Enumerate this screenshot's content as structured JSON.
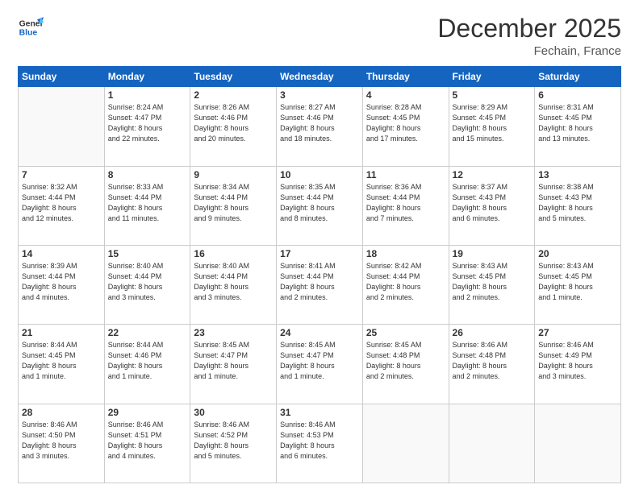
{
  "header": {
    "logo_general": "General",
    "logo_blue": "Blue",
    "month": "December 2025",
    "location": "Fechain, France"
  },
  "days_of_week": [
    "Sunday",
    "Monday",
    "Tuesday",
    "Wednesday",
    "Thursday",
    "Friday",
    "Saturday"
  ],
  "weeks": [
    [
      {
        "day": "",
        "info": ""
      },
      {
        "day": "1",
        "info": "Sunrise: 8:24 AM\nSunset: 4:47 PM\nDaylight: 8 hours\nand 22 minutes."
      },
      {
        "day": "2",
        "info": "Sunrise: 8:26 AM\nSunset: 4:46 PM\nDaylight: 8 hours\nand 20 minutes."
      },
      {
        "day": "3",
        "info": "Sunrise: 8:27 AM\nSunset: 4:46 PM\nDaylight: 8 hours\nand 18 minutes."
      },
      {
        "day": "4",
        "info": "Sunrise: 8:28 AM\nSunset: 4:45 PM\nDaylight: 8 hours\nand 17 minutes."
      },
      {
        "day": "5",
        "info": "Sunrise: 8:29 AM\nSunset: 4:45 PM\nDaylight: 8 hours\nand 15 minutes."
      },
      {
        "day": "6",
        "info": "Sunrise: 8:31 AM\nSunset: 4:45 PM\nDaylight: 8 hours\nand 13 minutes."
      }
    ],
    [
      {
        "day": "7",
        "info": "Sunrise: 8:32 AM\nSunset: 4:44 PM\nDaylight: 8 hours\nand 12 minutes."
      },
      {
        "day": "8",
        "info": "Sunrise: 8:33 AM\nSunset: 4:44 PM\nDaylight: 8 hours\nand 11 minutes."
      },
      {
        "day": "9",
        "info": "Sunrise: 8:34 AM\nSunset: 4:44 PM\nDaylight: 8 hours\nand 9 minutes."
      },
      {
        "day": "10",
        "info": "Sunrise: 8:35 AM\nSunset: 4:44 PM\nDaylight: 8 hours\nand 8 minutes."
      },
      {
        "day": "11",
        "info": "Sunrise: 8:36 AM\nSunset: 4:44 PM\nDaylight: 8 hours\nand 7 minutes."
      },
      {
        "day": "12",
        "info": "Sunrise: 8:37 AM\nSunset: 4:43 PM\nDaylight: 8 hours\nand 6 minutes."
      },
      {
        "day": "13",
        "info": "Sunrise: 8:38 AM\nSunset: 4:43 PM\nDaylight: 8 hours\nand 5 minutes."
      }
    ],
    [
      {
        "day": "14",
        "info": "Sunrise: 8:39 AM\nSunset: 4:44 PM\nDaylight: 8 hours\nand 4 minutes."
      },
      {
        "day": "15",
        "info": "Sunrise: 8:40 AM\nSunset: 4:44 PM\nDaylight: 8 hours\nand 3 minutes."
      },
      {
        "day": "16",
        "info": "Sunrise: 8:40 AM\nSunset: 4:44 PM\nDaylight: 8 hours\nand 3 minutes."
      },
      {
        "day": "17",
        "info": "Sunrise: 8:41 AM\nSunset: 4:44 PM\nDaylight: 8 hours\nand 2 minutes."
      },
      {
        "day": "18",
        "info": "Sunrise: 8:42 AM\nSunset: 4:44 PM\nDaylight: 8 hours\nand 2 minutes."
      },
      {
        "day": "19",
        "info": "Sunrise: 8:43 AM\nSunset: 4:45 PM\nDaylight: 8 hours\nand 2 minutes."
      },
      {
        "day": "20",
        "info": "Sunrise: 8:43 AM\nSunset: 4:45 PM\nDaylight: 8 hours\nand 1 minute."
      }
    ],
    [
      {
        "day": "21",
        "info": "Sunrise: 8:44 AM\nSunset: 4:45 PM\nDaylight: 8 hours\nand 1 minute."
      },
      {
        "day": "22",
        "info": "Sunrise: 8:44 AM\nSunset: 4:46 PM\nDaylight: 8 hours\nand 1 minute."
      },
      {
        "day": "23",
        "info": "Sunrise: 8:45 AM\nSunset: 4:47 PM\nDaylight: 8 hours\nand 1 minute."
      },
      {
        "day": "24",
        "info": "Sunrise: 8:45 AM\nSunset: 4:47 PM\nDaylight: 8 hours\nand 1 minute."
      },
      {
        "day": "25",
        "info": "Sunrise: 8:45 AM\nSunset: 4:48 PM\nDaylight: 8 hours\nand 2 minutes."
      },
      {
        "day": "26",
        "info": "Sunrise: 8:46 AM\nSunset: 4:48 PM\nDaylight: 8 hours\nand 2 minutes."
      },
      {
        "day": "27",
        "info": "Sunrise: 8:46 AM\nSunset: 4:49 PM\nDaylight: 8 hours\nand 3 minutes."
      }
    ],
    [
      {
        "day": "28",
        "info": "Sunrise: 8:46 AM\nSunset: 4:50 PM\nDaylight: 8 hours\nand 3 minutes."
      },
      {
        "day": "29",
        "info": "Sunrise: 8:46 AM\nSunset: 4:51 PM\nDaylight: 8 hours\nand 4 minutes."
      },
      {
        "day": "30",
        "info": "Sunrise: 8:46 AM\nSunset: 4:52 PM\nDaylight: 8 hours\nand 5 minutes."
      },
      {
        "day": "31",
        "info": "Sunrise: 8:46 AM\nSunset: 4:53 PM\nDaylight: 8 hours\nand 6 minutes."
      },
      {
        "day": "",
        "info": ""
      },
      {
        "day": "",
        "info": ""
      },
      {
        "day": "",
        "info": ""
      }
    ]
  ]
}
